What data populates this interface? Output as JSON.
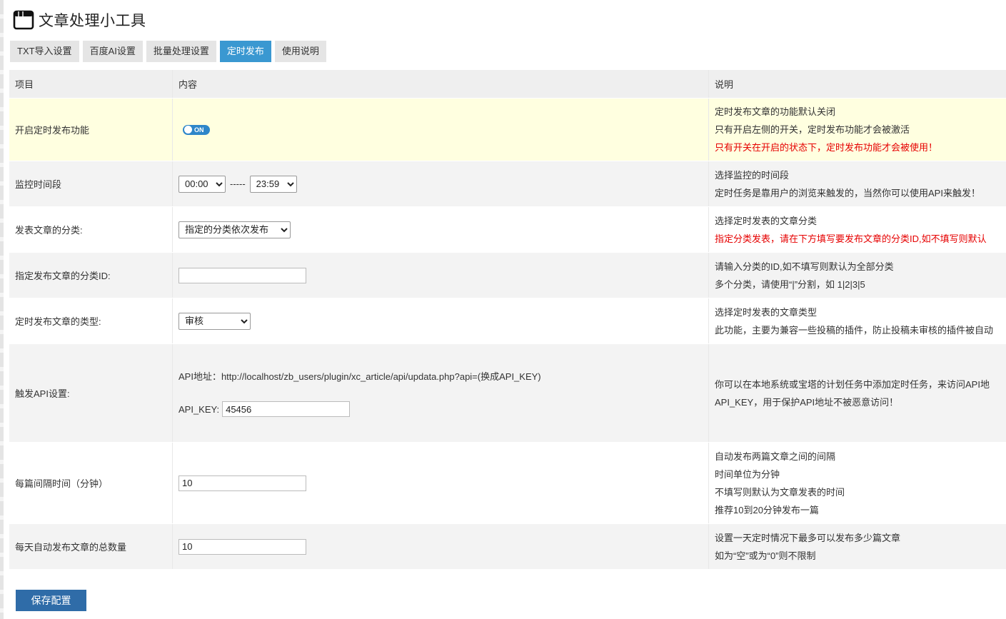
{
  "app": {
    "title": "文章处理小工具"
  },
  "tabs": [
    {
      "label": "TXT导入设置"
    },
    {
      "label": "百度AI设置"
    },
    {
      "label": "批量处理设置"
    },
    {
      "label": "定时发布"
    },
    {
      "label": "使用说明"
    }
  ],
  "table": {
    "headers": [
      "项目",
      "内容",
      "说明"
    ],
    "rows": [
      {
        "label": "开启定时发布功能",
        "toggle_text": "ON",
        "notes": [
          "定时发布文章的功能默认关闭",
          "只有开启左侧的开关，定时发布功能才会被激活",
          "只有开关在开启的状态下，定时发布功能才会被使用！"
        ]
      },
      {
        "label": "监控时间段",
        "start": "00:00",
        "separator": "-----",
        "end": "23:59",
        "notes": [
          "选择监控的时间段",
          "定时任务是靠用户的浏览来触发的，当然你可以使用API来触发！"
        ]
      },
      {
        "label": "发表文章的分类:",
        "select": "指定的分类依次发布",
        "notes": [
          "选择定时发表的文章分类",
          "指定分类发表，请在下方填写要发布文章的分类ID,如不填写则默认"
        ]
      },
      {
        "label": "指定发布文章的分类ID:",
        "value": "",
        "notes": [
          "请输入分类的ID,如不填写则默认为全部分类",
          "多个分类，请使用“|”分割，如 1|2|3|5"
        ]
      },
      {
        "label": "定时发布文章的类型:",
        "select": "审核",
        "notes": [
          "选择定时发表的文章类型",
          "此功能，主要为兼容一些投稿的插件，防止投稿未审核的插件被自动"
        ]
      },
      {
        "label": "触发API设置:",
        "api_url": "API地址：http://localhost/zb_users/plugin/xc_article/api/updata.php?api=(换成API_KEY)",
        "api_key_label": "API_KEY:",
        "api_key": "45456",
        "notes": [
          "你可以在本地系统或宝塔的计划任务中添加定时任务，来访问API地",
          "API_KEY，用于保护API地址不被恶意访问！"
        ]
      },
      {
        "label": "每篇间隔时间（分钟）",
        "value": "10",
        "notes": [
          "自动发布两篇文章之间的间隔",
          "时间单位为分钟",
          "不填写则默认为文章发表的时间",
          "推荐10到20分钟发布一篇"
        ]
      },
      {
        "label": "每天自动发布文章的总数量",
        "value": "10",
        "notes": [
          "设置一天定时情况下最多可以发布多少篇文章",
          "如为“空”或为“0”则不限制"
        ]
      }
    ]
  },
  "save_button": "保存配置",
  "colors": {
    "accent": "#3a98d1",
    "save": "#2f6ca8",
    "warning": "#e60000",
    "highlight_row": "#ffffe0"
  },
  "icons": {
    "app": "window-icon"
  }
}
